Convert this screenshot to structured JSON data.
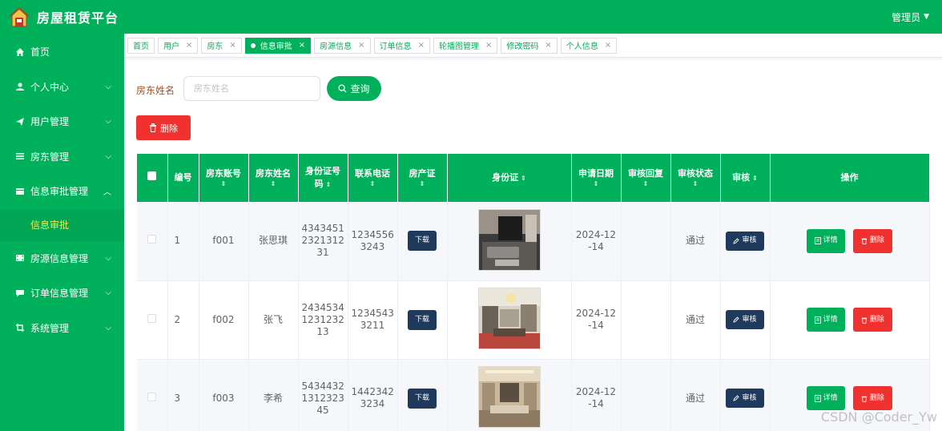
{
  "header": {
    "brand": "房屋租赁平台",
    "user": "管理员",
    "brand_color": "#00b05a"
  },
  "sidebar": {
    "items": [
      {
        "label": "首页",
        "icon": "home-icon",
        "has_arrow": false
      },
      {
        "label": "个人中心",
        "icon": "user-icon",
        "has_arrow": true
      },
      {
        "label": "用户管理",
        "icon": "send-icon",
        "has_arrow": true
      },
      {
        "label": "房东管理",
        "icon": "list-icon",
        "has_arrow": true
      },
      {
        "label": "信息审批管理",
        "icon": "folder-icon",
        "has_arrow": true,
        "expanded": true
      },
      {
        "label": "房源信息管理",
        "icon": "film-icon",
        "has_arrow": true
      },
      {
        "label": "订单信息管理",
        "icon": "chat-icon",
        "has_arrow": true
      },
      {
        "label": "系统管理",
        "icon": "crop-icon",
        "has_arrow": true
      }
    ],
    "submenu_active": "信息审批"
  },
  "tabs": [
    {
      "label": "首页",
      "closable": false,
      "active": false
    },
    {
      "label": "用户",
      "closable": true,
      "active": false
    },
    {
      "label": "房东",
      "closable": true,
      "active": false
    },
    {
      "label": "信息审批",
      "closable": true,
      "active": true
    },
    {
      "label": "房源信息",
      "closable": true,
      "active": false
    },
    {
      "label": "订单信息",
      "closable": true,
      "active": false
    },
    {
      "label": "轮播图管理",
      "closable": true,
      "active": false
    },
    {
      "label": "修改密码",
      "closable": true,
      "active": false
    },
    {
      "label": "个人信息",
      "closable": true,
      "active": false
    }
  ],
  "search": {
    "label": "房东姓名",
    "placeholder": "房东姓名",
    "button": "查询"
  },
  "toolbar": {
    "delete_label": "删除"
  },
  "table": {
    "columns": [
      "编号",
      "房东账号",
      "房东姓名",
      "身份证号码",
      "联系电话",
      "房产证",
      "身份证",
      "申请日期",
      "审核回复",
      "审核状态",
      "审核",
      "操作"
    ],
    "rows": [
      {
        "no": "1",
        "account": "f001",
        "name": "张思琪",
        "idcard": "434345123213 1231",
        "idcard_lines": [
          "4343451",
          "2321312",
          "31"
        ],
        "phone_lines": [
          "1234556",
          "3243"
        ],
        "cert_btn": "下载",
        "date_lines": [
          "2024-12",
          "-14"
        ],
        "reply": "",
        "status": "通过",
        "audit_btn": "审核",
        "detail_btn": "详情",
        "delete_btn": "删除"
      },
      {
        "no": "2",
        "account": "f002",
        "name": "张飞",
        "idcard_lines": [
          "2434534",
          "1231232",
          "13"
        ],
        "phone_lines": [
          "1234543",
          "3211"
        ],
        "cert_btn": "下载",
        "date_lines": [
          "2024-12",
          "-14"
        ],
        "reply": "",
        "status": "通过",
        "audit_btn": "审核",
        "detail_btn": "详情",
        "delete_btn": "删除"
      },
      {
        "no": "3",
        "account": "f003",
        "name": "李希",
        "idcard_lines": [
          "5434432",
          "1312323",
          "45"
        ],
        "phone_lines": [
          "1442342",
          "3234"
        ],
        "cert_btn": "下载",
        "date_lines": [
          "2024-12",
          "-14"
        ],
        "reply": "",
        "status": "通过",
        "audit_btn": "审核",
        "detail_btn": "详情",
        "delete_btn": "删除"
      }
    ]
  },
  "watermark": "CSDN @Coder_Yw"
}
